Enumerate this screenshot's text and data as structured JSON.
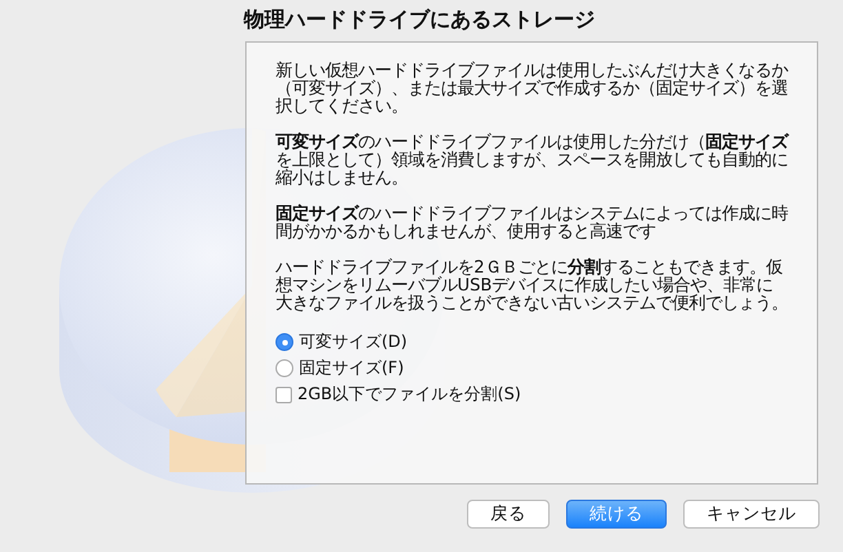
{
  "title": "物理ハードドライブにあるストレージ",
  "paragraphs": [
    "新しい仮想ハードドライブファイルは使用したぶんだけ大きくなるか（可変サイズ）、または最大サイズで作成するか（固定サイズ）を選択してください。",
    "**可変サイズ**のハードドライブファイルは使用した分だけ（**固定サイズ**を上限として）領域を消費しますが、スペースを開放しても自動的に縮小はしません。",
    "**固定サイズ**のハードドライブファイルはシステムによっては作成に時間がかかるかもしれませんが、使用すると高速です",
    "ハードドライブファイルを2ＧＢごとに**分割**することもできます。仮想マシンをリムーバブルUSBデバイスに作成したい場合や、非常に大きなファイルを扱うことができない古いシステムで便利でしょう。"
  ],
  "options": [
    {
      "kind": "radio",
      "label": "可変サイズ(D)",
      "selected": true
    },
    {
      "kind": "radio",
      "label": "固定サイズ(F)",
      "selected": false
    },
    {
      "kind": "checkbox",
      "label": "2GB以下でファイルを分割(S)",
      "checked": false
    }
  ],
  "buttons": [
    {
      "label": "戻る",
      "default": false
    },
    {
      "label": "続ける",
      "default": true
    },
    {
      "label": "キャンセル",
      "default": false
    }
  ]
}
